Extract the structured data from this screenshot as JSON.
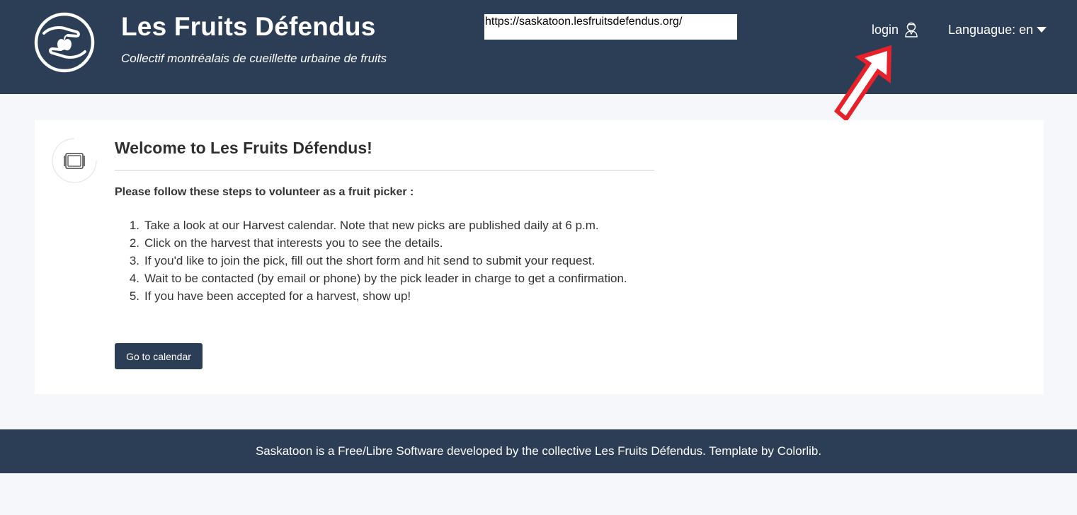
{
  "header": {
    "title": "Les Fruits Défendus",
    "subtitle": "Collectif montréalais de cueillette urbaine de fruits",
    "url": "https://saskatoon.lesfruitsdefendus.org/",
    "login_label": "login",
    "language_label": "Languague: en",
    "icons": {
      "logo": "hands-apple-logo",
      "login": "user-icon",
      "language_caret": "caret-down-icon"
    }
  },
  "annotation": {
    "arrow_color": "#e8202a",
    "points_to": "login"
  },
  "card": {
    "title": "Welcome to Les Fruits Défendus!",
    "intro": "Please follow these steps to volunteer as a fruit picker :",
    "steps": [
      {
        "num": "1.",
        "text": "Take a look at our Harvest calendar. Note that new picks are published daily at 6 p.m."
      },
      {
        "num": "2.",
        "text": "Click on the harvest that interests you to see the details."
      },
      {
        "num": "3.",
        "text": "If you'd like to join the pick, fill out the short form and hit send to submit your request."
      },
      {
        "num": "4.",
        "text": "Wait to be contacted (by email or phone) by the pick leader in charge to get a confirmation."
      },
      {
        "num": "5.",
        "text": "If you have been accepted for a harvest, show up!"
      }
    ],
    "button_label": "Go to calendar",
    "badge_icon": "layers-icon"
  },
  "footer": {
    "text": "Saskatoon is a Free/Libre Software developed by the collective Les Fruits Défendus. Template by Colorlib."
  },
  "colors": {
    "primary": "#2c3e55",
    "background": "#f6f7fa",
    "card": "#ffffff",
    "text": "#333333"
  }
}
